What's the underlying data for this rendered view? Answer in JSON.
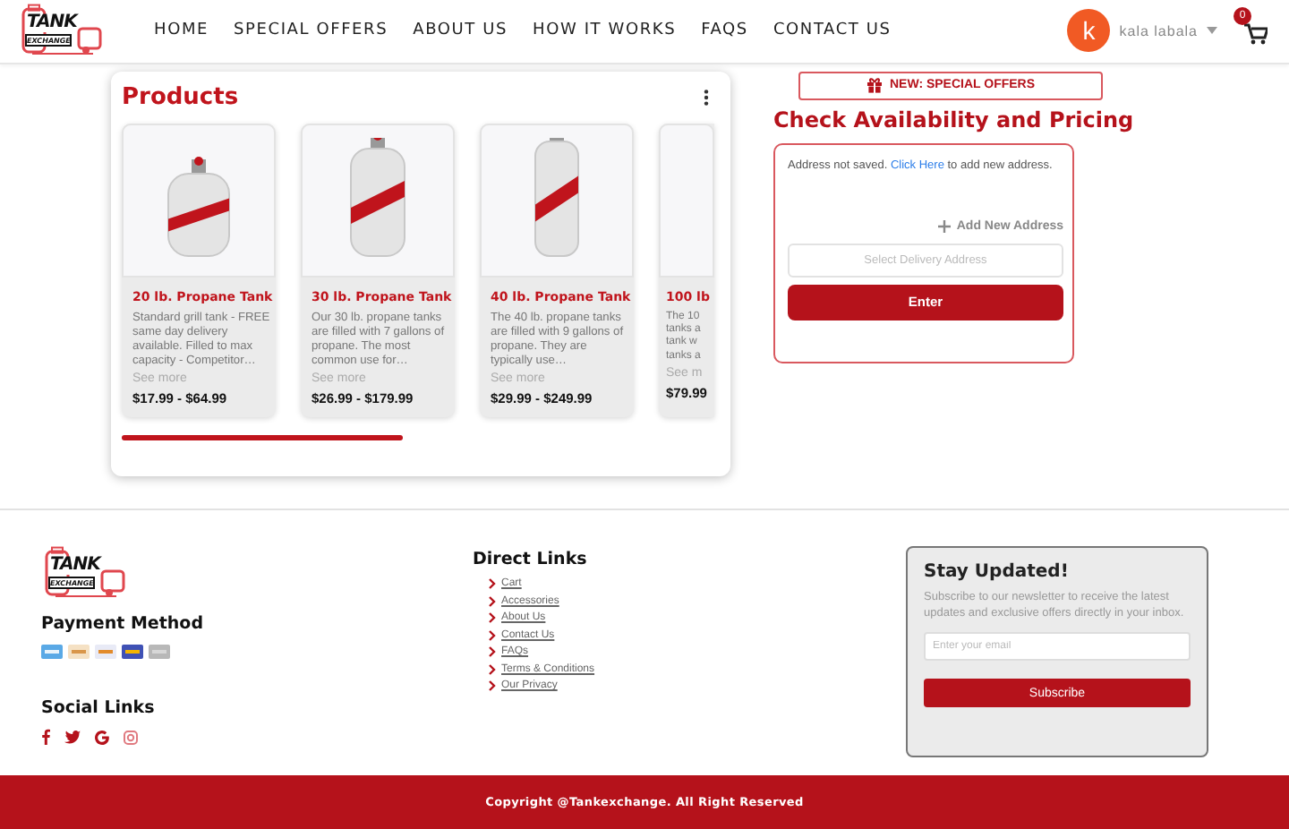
{
  "header": {
    "logo": {
      "top": "TANK",
      "bottom": "EXCHANGE"
    },
    "nav": [
      {
        "label": "HOME"
      },
      {
        "label": "SPECIAL OFFERS"
      },
      {
        "label": "ABOUT US"
      },
      {
        "label": "HOW IT WORKS"
      },
      {
        "label": "FAQS"
      },
      {
        "label": "CONTACT US"
      }
    ],
    "user": {
      "initial": "k",
      "name": "kala labala"
    },
    "cart": {
      "count": "0"
    }
  },
  "products": {
    "title": "Products",
    "items": [
      {
        "title": "20 lb. Propane Tank",
        "description": "Standard grill tank - FREE same day delivery available. Filled to max capacity - Competitor…",
        "more": "See more",
        "price": "$17.99 - $64.99",
        "kind": "full"
      },
      {
        "title": "30 lb. Propane Tank",
        "description": "Our 30 lb. propane tanks are filled with 7 gallons of propane. The most common use for…",
        "more": "See more",
        "price": "$26.99 - $179.99",
        "kind": "full"
      },
      {
        "title": "40 lb. Propane Tank",
        "description": "The 40 lb. propane tanks are filled with 9 gallons of propane. They are typically use…",
        "more": "See more",
        "price": "$29.99 - $249.99",
        "kind": "full"
      },
      {
        "title": "100 lb",
        "description": "The 10 tanks a tank w tanks a",
        "more": "See m",
        "price": "$79.99",
        "kind": "partial"
      }
    ]
  },
  "availability": {
    "offer_button": "NEW: SPECIAL OFFERS",
    "title": "Check Availability and Pricing",
    "notice": {
      "before": "Address not saved.",
      "link": "Click Here",
      "after": "to add new address."
    },
    "add_address": "Add New Address",
    "select_placeholder": "Select Delivery Address",
    "enter_button": "Enter"
  },
  "footer": {
    "logo": {
      "top": "TANK",
      "bottom": "EXCHANGE"
    },
    "payment_title": "Payment Method",
    "social_title": "Social Links",
    "links_title": "Direct Links",
    "links": [
      {
        "label": "Cart"
      },
      {
        "label": "Accessories"
      },
      {
        "label": "About Us"
      },
      {
        "label": "Contact Us"
      },
      {
        "label": "FAQs"
      },
      {
        "label": "Terms & Conditions"
      },
      {
        "label": "Our Privacy"
      }
    ],
    "newsletter": {
      "title": "Stay Updated!",
      "text": "Subscribe to our newsletter to receive the latest updates and exclusive offers directly in your inbox.",
      "placeholder": "Enter your email",
      "button": "Subscribe"
    },
    "copyright": "Copyright @Tankexchange. All Right Reserved"
  }
}
